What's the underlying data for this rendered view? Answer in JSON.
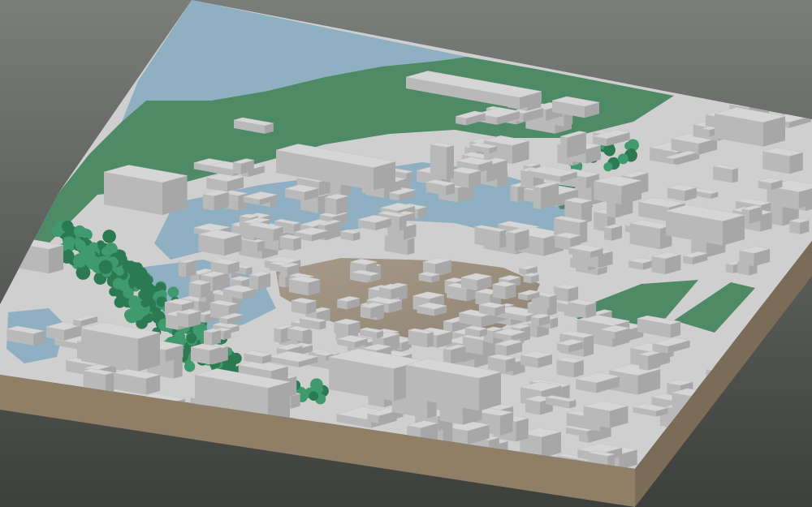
{
  "scene": {
    "subject": "3d-city-block-model",
    "colors": {
      "background_top": "#7a7d7a",
      "background_bottom": "#3d3f3d",
      "water": "#8fb0c2",
      "water_dark": "#7d9fb2",
      "park": "#4f8a66",
      "park_dark": "#3f7657",
      "trees": "#3f9a6e",
      "trees_dark": "#2c7a52",
      "terrain": "#a79a88",
      "terrain_dark": "#8f8373",
      "base_side": "#8f7f67",
      "base_side_dark": "#7a6c57",
      "building_top": "#d6d6d6",
      "building_side": "#b9b9b9",
      "building_shadow": "#a7a7a7",
      "road": "#cfcfcf"
    }
  }
}
